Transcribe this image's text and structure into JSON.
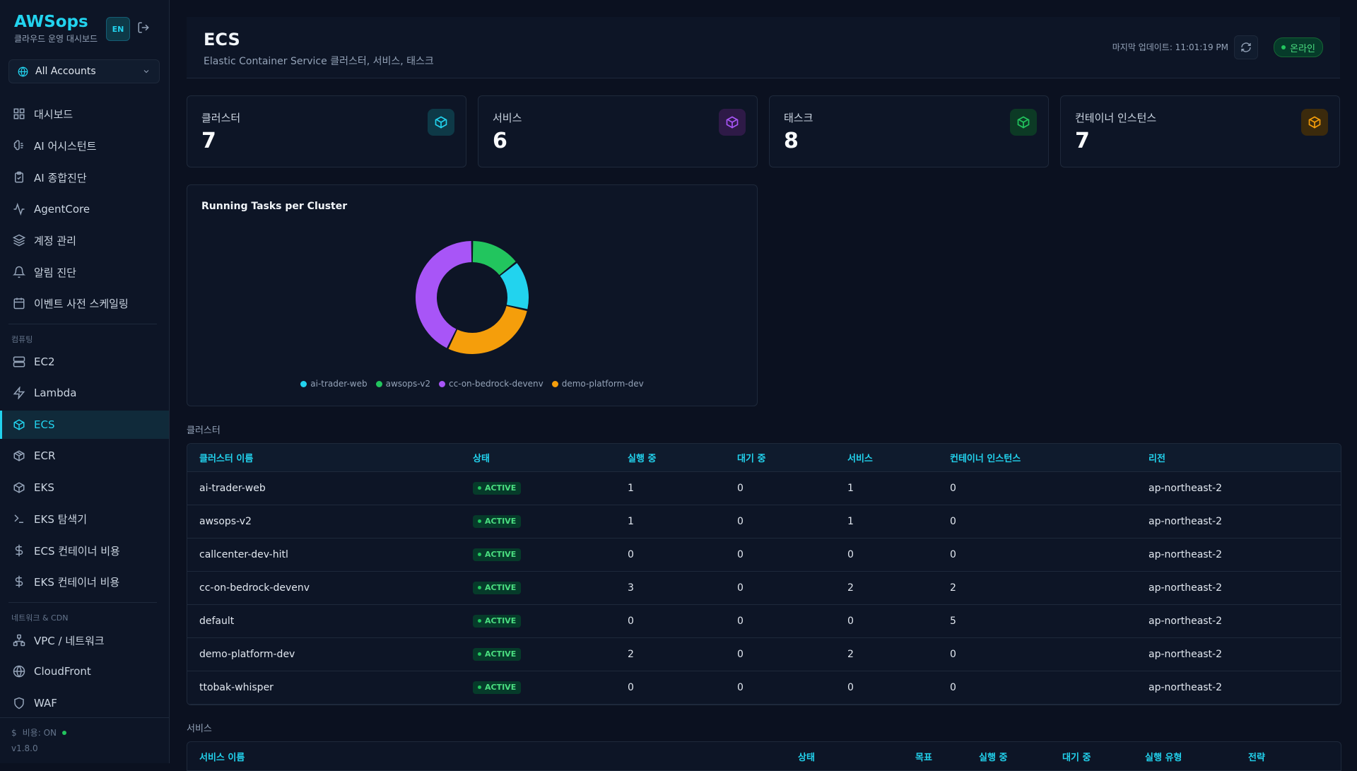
{
  "app": {
    "name": "AWSops",
    "subtitle": "클라우드 운영 대시보드",
    "lang_button": "EN",
    "version": "v1.8.0",
    "cost_status": "비용: ON"
  },
  "account_selector": {
    "label": "All Accounts"
  },
  "sidebar": {
    "items": [
      {
        "label": "대시보드",
        "icon": "grid-icon"
      },
      {
        "label": "AI 어시스턴트",
        "icon": "brain-icon"
      },
      {
        "label": "AI 종합진단",
        "icon": "clipboard-icon"
      },
      {
        "label": "AgentCore",
        "icon": "activity-icon"
      },
      {
        "label": "계정 관리",
        "icon": "layers-icon"
      },
      {
        "label": "알림 진단",
        "icon": "bell-icon"
      },
      {
        "label": "이벤트 사전 스케일링",
        "icon": "calendar-icon"
      }
    ],
    "section_compute": "컴퓨팅",
    "compute_items": [
      {
        "label": "EC2",
        "icon": "server-icon"
      },
      {
        "label": "Lambda",
        "icon": "zap-icon"
      },
      {
        "label": "ECS",
        "icon": "box-icon",
        "active": true
      },
      {
        "label": "ECR",
        "icon": "package-icon"
      },
      {
        "label": "EKS",
        "icon": "cube-icon"
      },
      {
        "label": "EKS 탐색기",
        "icon": "terminal-icon"
      },
      {
        "label": "ECS 컨테이너 비용",
        "icon": "dollar-icon"
      },
      {
        "label": "EKS 컨테이너 비용",
        "icon": "dollar-icon"
      }
    ],
    "section_network": "네트워크 & CDN",
    "network_items": [
      {
        "label": "VPC / 네트워크",
        "icon": "network-icon"
      },
      {
        "label": "CloudFront",
        "icon": "globe-icon"
      },
      {
        "label": "WAF",
        "icon": "shield-icon"
      }
    ]
  },
  "header": {
    "title": "ECS",
    "subtitle": "Elastic Container Service 클러스터, 서비스, 태스크",
    "last_update": "마지막 업데이트: 11:01:19 PM",
    "status": "온라인"
  },
  "stats": [
    {
      "label": "클러스터",
      "value": "7",
      "color": "#22d3ee"
    },
    {
      "label": "서비스",
      "value": "6",
      "color": "#a855f7"
    },
    {
      "label": "태스크",
      "value": "8",
      "color": "#22c55e"
    },
    {
      "label": "컨테이너 인스턴스",
      "value": "7",
      "color": "#f59e0b"
    }
  ],
  "chart_data": {
    "type": "pie",
    "title": "Running Tasks per Cluster",
    "categories": [
      "ai-trader-web",
      "awsops-v2",
      "cc-on-bedrock-devenv",
      "demo-platform-dev"
    ],
    "values": [
      1,
      1,
      3,
      2
    ],
    "colors": [
      "#22d3ee",
      "#22c55e",
      "#a855f7",
      "#f59e0b"
    ],
    "legend_position": "bottom"
  },
  "clusters_section": "클러스터",
  "clusters_table": {
    "headers": [
      "클러스터 이름",
      "상태",
      "실행 중",
      "대기 중",
      "서비스",
      "컨테이너 인스턴스",
      "리전"
    ],
    "rows": [
      [
        "ai-trader-web",
        "ACTIVE",
        "1",
        "0",
        "1",
        "0",
        "ap-northeast-2"
      ],
      [
        "awsops-v2",
        "ACTIVE",
        "1",
        "0",
        "1",
        "0",
        "ap-northeast-2"
      ],
      [
        "callcenter-dev-hitl",
        "ACTIVE",
        "0",
        "0",
        "0",
        "0",
        "ap-northeast-2"
      ],
      [
        "cc-on-bedrock-devenv",
        "ACTIVE",
        "3",
        "0",
        "2",
        "2",
        "ap-northeast-2"
      ],
      [
        "default",
        "ACTIVE",
        "0",
        "0",
        "0",
        "5",
        "ap-northeast-2"
      ],
      [
        "demo-platform-dev",
        "ACTIVE",
        "2",
        "0",
        "2",
        "0",
        "ap-northeast-2"
      ],
      [
        "ttobak-whisper",
        "ACTIVE",
        "0",
        "0",
        "0",
        "0",
        "ap-northeast-2"
      ]
    ]
  },
  "services_section": "서비스",
  "services_table": {
    "headers": [
      "서비스 이름",
      "상태",
      "목표",
      "실행 중",
      "대기 중",
      "실행 유형",
      "전략"
    ]
  }
}
